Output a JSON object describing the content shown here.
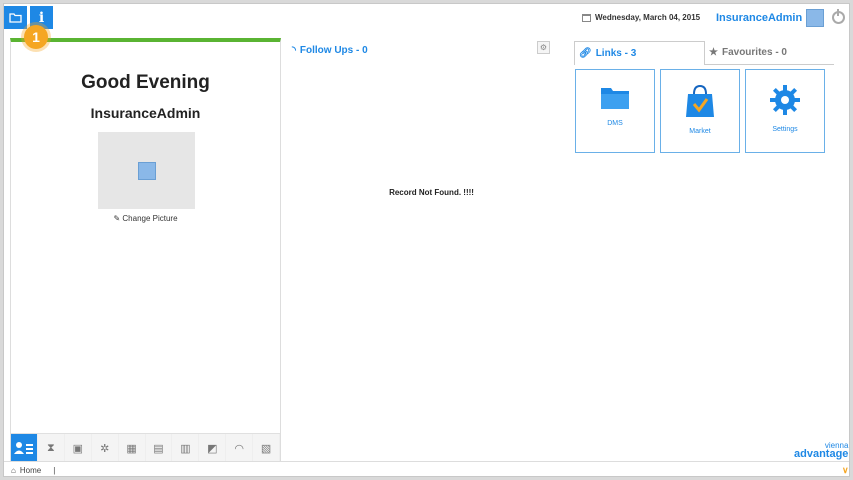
{
  "topbar": {
    "date": "Wednesday, March 04, 2015",
    "username": "InsuranceAdmin",
    "folder_icon": "folder-icon",
    "info_label": "i",
    "badge": "1"
  },
  "left": {
    "greeting": "Good Evening",
    "username": "InsuranceAdmin",
    "change_picture": "Change Picture",
    "bottom_tabs": [
      "user-card-icon",
      "hourglass-icon",
      "clipboard-icon",
      "bug-icon",
      "calendar-icon",
      "notes-icon",
      "document-icon",
      "edit-icon",
      "gauge-icon",
      "report-icon"
    ]
  },
  "followups": {
    "label": "Follow Ups - 0",
    "empty_text": "Record Not Found. !!!!"
  },
  "right": {
    "links_tab": "Links - 3",
    "favourites_tab": "Favourites - 0",
    "tiles": [
      {
        "label": "DMS",
        "icon": "folder-icon"
      },
      {
        "label": "Market",
        "icon": "shopping-bag-icon"
      },
      {
        "label": "Settings",
        "icon": "gear-icon"
      }
    ]
  },
  "statusbar": {
    "home": "Home",
    "separator": "|"
  },
  "logo": {
    "line1": "vienna",
    "line2": "advantage"
  },
  "colors": {
    "accent": "#1e88e5",
    "green": "#5ab432",
    "badge": "#f5a623"
  }
}
